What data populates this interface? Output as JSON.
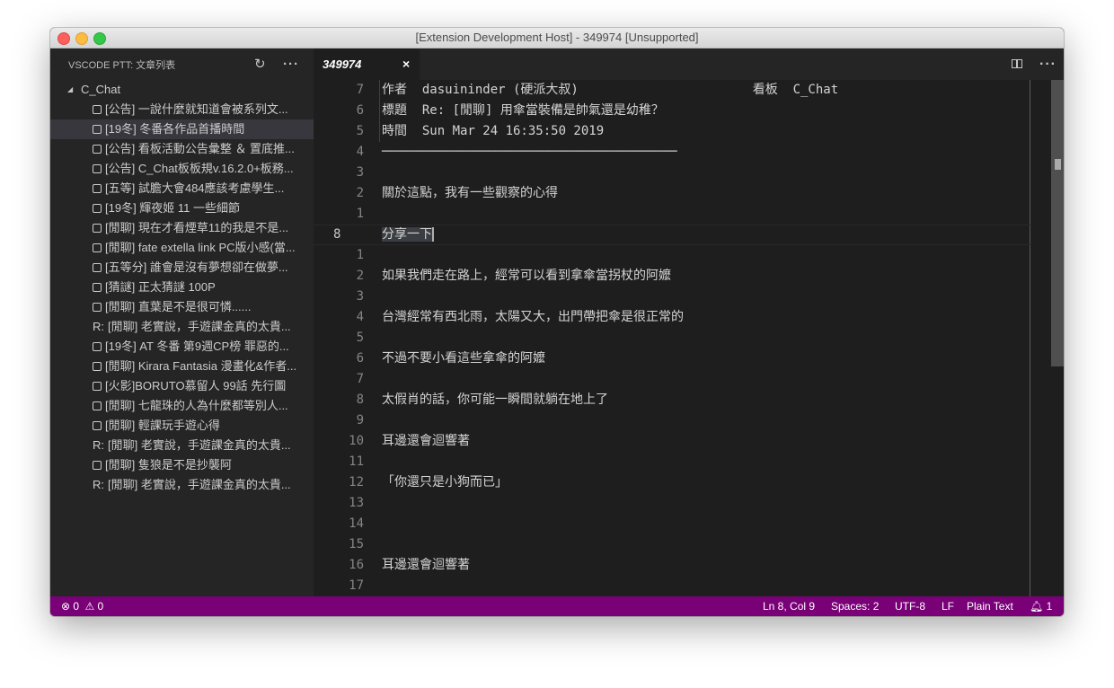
{
  "window": {
    "title": "[Extension Development Host] - 349974 [Unsupported]"
  },
  "sidebar": {
    "title": "VSCODE PTT: 文章列表",
    "root": "C_Chat",
    "items": [
      {
        "prefix": "box",
        "label": "[公告] 一說什麼就知道會被系列文..."
      },
      {
        "prefix": "box",
        "label": "[19冬] 冬番各作品首播時間",
        "selected": true
      },
      {
        "prefix": "box",
        "label": "[公告] 看板活動公告彙整 ＆ 置底推..."
      },
      {
        "prefix": "box",
        "label": "[公告] C_Chat板板規v.16.2.0+板務..."
      },
      {
        "prefix": "box",
        "label": "[五等] 試膽大會484應該考慮學生..."
      },
      {
        "prefix": "box",
        "label": "[19冬] 輝夜姬 11 一些細節"
      },
      {
        "prefix": "box",
        "label": "[閒聊] 現在才看煙草11的我是不是..."
      },
      {
        "prefix": "box",
        "label": "[閒聊] fate extella link PC版小感(當..."
      },
      {
        "prefix": "box",
        "label": "[五等分] 誰會是沒有夢想卻在做夢..."
      },
      {
        "prefix": "box",
        "label": "[猜謎] 正太猜謎 100P"
      },
      {
        "prefix": "box",
        "label": "[閒聊] 直葉是不是很可憐......"
      },
      {
        "prefix": "R:",
        "label": "[閒聊] 老實說，手遊課金真的太貴..."
      },
      {
        "prefix": "box",
        "label": "[19冬] AT 冬番 第9週CP榜 罪惡的..."
      },
      {
        "prefix": "box",
        "label": "[閒聊] Kirara Fantasia 漫畫化&作者..."
      },
      {
        "prefix": "box",
        "label": "[火影]BORUTO慕留人 99話 先行圖"
      },
      {
        "prefix": "box",
        "label": "[閒聊] 七龍珠的人為什麼都等別人..."
      },
      {
        "prefix": "box",
        "label": "[閒聊] 輕課玩手遊心得"
      },
      {
        "prefix": "R:",
        "label": "[閒聊] 老實說，手遊課金真的太貴..."
      },
      {
        "prefix": "box",
        "label": "[閒聊] 隻狼是不是抄襲阿"
      },
      {
        "prefix": "R:",
        "label": "[閒聊] 老實說，手遊課金真的太貴..."
      }
    ]
  },
  "editor": {
    "tab": "349974",
    "close": "×",
    "lines": [
      {
        "n": "7",
        "t": "作者  dasuininder (硬派大叔)                       看板  C_Chat"
      },
      {
        "n": "6",
        "t": "標題  Re: [閒聊] 用傘當裝備是帥氣還是幼稚？"
      },
      {
        "n": "5",
        "t": "時間  Sun Mar 24 16:35:50 2019"
      },
      {
        "n": "4",
        "t": "───────────────────────────────────────"
      },
      {
        "n": "3",
        "t": ""
      },
      {
        "n": "2",
        "t": "關於這點，我有一些觀察的心得"
      },
      {
        "n": "1",
        "t": ""
      },
      {
        "n": "8",
        "t": "分享一下",
        "current": true
      },
      {
        "n": "1",
        "t": ""
      },
      {
        "n": "2",
        "t": "如果我們走在路上，經常可以看到拿傘當拐杖的阿嬤"
      },
      {
        "n": "3",
        "t": ""
      },
      {
        "n": "4",
        "t": "台灣經常有西北雨，太陽又大，出門帶把傘是很正常的"
      },
      {
        "n": "5",
        "t": ""
      },
      {
        "n": "6",
        "t": "不過不要小看這些拿傘的阿嬤"
      },
      {
        "n": "7",
        "t": ""
      },
      {
        "n": "8",
        "t": "太假肖的話，你可能一瞬間就躺在地上了"
      },
      {
        "n": "9",
        "t": ""
      },
      {
        "n": "10",
        "t": "耳邊還會迴響著"
      },
      {
        "n": "11",
        "t": ""
      },
      {
        "n": "12",
        "t": "「你還只是小狗而已」"
      },
      {
        "n": "13",
        "t": ""
      },
      {
        "n": "14",
        "t": ""
      },
      {
        "n": "15",
        "t": ""
      },
      {
        "n": "16",
        "t": "耳邊還會迴響著"
      },
      {
        "n": "17",
        "t": ""
      }
    ]
  },
  "status": {
    "errors": "0",
    "warnings": "0",
    "position": "Ln 8, Col 9",
    "spaces": "Spaces: 2",
    "encoding": "UTF-8",
    "eol": "LF",
    "language": "Plain Text",
    "notifications": "1"
  },
  "colors": {
    "status_bar": "#7a0078",
    "editor_bg": "#1e1e1e",
    "sidebar_bg": "#252526"
  }
}
